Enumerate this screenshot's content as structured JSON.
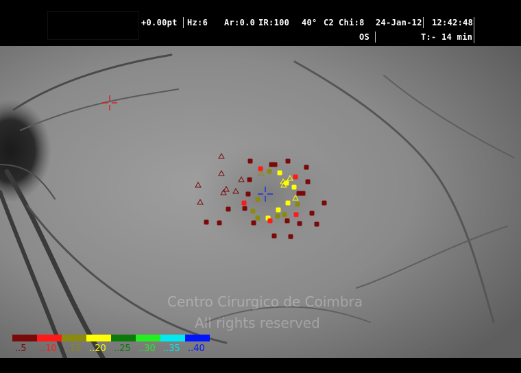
{
  "header": {
    "line1": {
      "refraction": "+0.00pt",
      "hz": "Hz:6",
      "ar": "Ar:0.0",
      "ir": "IR:100",
      "fov": "40°",
      "c2": "C2",
      "chi": "Chi:8",
      "date": "24-Jan-12",
      "time": "12:42:48"
    },
    "line2": {
      "eye": "OS",
      "duration": "T:- 14 min"
    }
  },
  "watermark": {
    "line1": "Centro Cirurgico de Coimbra",
    "line2": "All rights reserved"
  },
  "legend": [
    {
      "label": "..5",
      "color": "#7a0a0a"
    },
    {
      "label": "..10",
      "color": "#ff1a1a"
    },
    {
      "label": "..15",
      "color": "#8a8a10"
    },
    {
      "label": "..20",
      "color": "#ffff00"
    },
    {
      "label": "..25",
      "color": "#0a7a0a"
    },
    {
      "label": "..30",
      "color": "#22ee22"
    },
    {
      "label": "..35",
      "color": "#00eaf0"
    },
    {
      "label": "..40",
      "color": "#0014ff"
    }
  ],
  "markers": {
    "fixation_target_color": "#d82020",
    "fixation_center_color": "#2030e0"
  }
}
